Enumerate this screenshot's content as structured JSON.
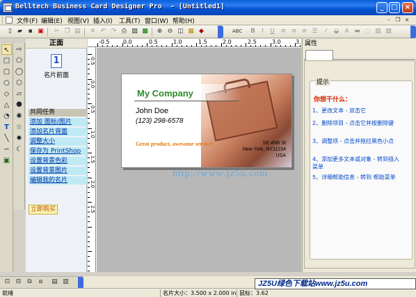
{
  "window": {
    "title": "Belltech Business Card Designer Pro  - [Untitled1]",
    "minimize": "_",
    "maximize": "□",
    "close": "×"
  },
  "menu": {
    "items": [
      "文件(F)",
      "编辑(E)",
      "视图(V)",
      "插入(I)",
      "工具(T)",
      "窗口(W)",
      "帮助(H)"
    ],
    "mdi_minimize": "-",
    "mdi_restore": "❐",
    "mdi_close": "×"
  },
  "toolbar": {
    "icons": [
      "new-icon",
      "open-icon",
      "save-icon",
      "pdf-icon",
      "cut-icon",
      "copy-icon",
      "paste-icon",
      "delete-icon",
      "undo-icon",
      "redo-icon",
      "print-icon",
      "print-preview-icon",
      "export-icon",
      "zoom-in-icon",
      "zoom-out-icon",
      "zoom-fit-icon",
      "grid-icon",
      "eraser-icon",
      "spellcheck-icon",
      "bold-icon",
      "italic-icon",
      "underline-icon",
      "align-left-icon",
      "align-center-icon",
      "align-right-icon",
      "justify-icon",
      "line-style-icon",
      "fill-icon",
      "font-color-icon",
      "shadow-icon"
    ],
    "spellcheck_label": "ABC",
    "bold_label": "B",
    "italic_label": "I",
    "underline_label": "U"
  },
  "taskpane": {
    "header": "正面",
    "page_number": "1",
    "page_caption": "名片前面",
    "tasks_header": "共同任务",
    "tasks": [
      "添加 图标/图片",
      "添加名片背面",
      "调整大小",
      "保存为 PrintShop",
      "设置背景色彩",
      "设置背景图片",
      "编辑我的名片"
    ],
    "order_button": "立即购买"
  },
  "ruler": {
    "top_labels": [
      "-0.5",
      "0.0",
      "0.5",
      "1.0",
      "1.5",
      "2.0",
      "2.5",
      "3.0",
      "3.5"
    ],
    "left_labels": [
      "-0.5",
      "0.0",
      "0.5",
      "1.0",
      "1.5",
      "2.0",
      "2.5"
    ]
  },
  "card": {
    "company": "My Company",
    "name": "John Doe",
    "phone": "(123) 298-6578",
    "slogan": "Great product, awesome service!",
    "address": [
      "SE 45th St",
      "New York, NY11234",
      "USA"
    ]
  },
  "watermark": "http://www.jz5u.com",
  "properties": {
    "header": "属性",
    "tips_legend": "提示",
    "tips_title": "你想干什么：",
    "tips": [
      "1、更改文本 - 双击它",
      "2、删除项目 - 点击它并按删除键",
      "3、调整项 - 点击并拖拉黑色小点",
      "4、添加更多文本或对象 - 转到插入菜单",
      "5、详细帮助信息 - 转到 帮助菜单"
    ]
  },
  "status": {
    "ready": "就绪",
    "card_size": "名片大小：3.500 x 2.000 in",
    "mouse": "鼠标：3.62",
    "brand": "JZ5U绿色下载站www.jz5u.com"
  },
  "colors": {
    "title_bar": "#0a5fdc",
    "company_green": "#2c8a2c",
    "slogan_orange": "#e07a10",
    "task_link_bg": "#bfeaf4",
    "tip_blue": "#0048c8",
    "tip_title_red": "#d82000"
  }
}
